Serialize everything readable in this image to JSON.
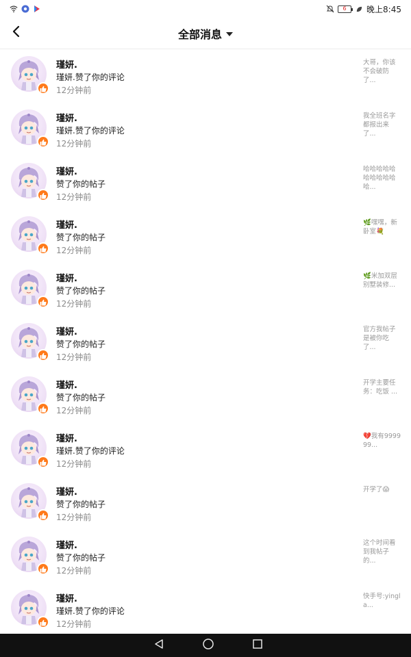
{
  "status_bar": {
    "time": "晚上8:45",
    "battery": "6"
  },
  "header": {
    "title": "全部消息"
  },
  "items": [
    {
      "name": "瑾妍.",
      "action": "瑾妍.赞了你的评论",
      "time": "12分钟前",
      "snippet": "大哥，你该不会破防了..."
    },
    {
      "name": "瑾妍.",
      "action": "瑾妍.赞了你的评论",
      "time": "12分钟前",
      "snippet": "我全班名字都报出来了..."
    },
    {
      "name": "瑾妍.",
      "action": "赞了你的帖子",
      "time": "12分钟前",
      "snippet": "哈哈哈哈哈哈哈哈哈哈哈..."
    },
    {
      "name": "瑾妍.",
      "action": "赞了你的帖子",
      "time": "12分钟前",
      "snippet": "🌿嘿嘿，新卧室💐"
    },
    {
      "name": "瑾妍.",
      "action": "赞了你的帖子",
      "time": "12分钟前",
      "snippet": "🌿米加双层别墅装修..."
    },
    {
      "name": "瑾妍.",
      "action": "赞了你的帖子",
      "time": "12分钟前",
      "snippet": "官方我帖子是被你吃了..."
    },
    {
      "name": "瑾妍.",
      "action": "赞了你的帖子",
      "time": "12分钟前",
      "snippet": "开学主要任务：吃饭 ..."
    },
    {
      "name": "瑾妍.",
      "action": "瑾妍.赞了你的评论",
      "time": "12分钟前",
      "snippet": "💔我有999999..."
    },
    {
      "name": "瑾妍.",
      "action": "赞了你的帖子",
      "time": "12分钟前",
      "snippet": "开学了😱"
    },
    {
      "name": "瑾妍.",
      "action": "赞了你的帖子",
      "time": "12分钟前",
      "snippet": "这个时间看到我帖子的..."
    },
    {
      "name": "瑾妍.",
      "action": "瑾妍.赞了你的评论",
      "time": "12分钟前",
      "snippet": "快手号:yingla..."
    }
  ],
  "colors": {
    "like_badge": "#ff7a1a",
    "nav_bar": "#111111",
    "avatar_bg": "#efe1f6"
  },
  "icons": {
    "back": "chevron-left-icon",
    "dropdown": "caret-down-icon",
    "like": "thumbs-up-icon",
    "nav_back": "triangle-back-icon",
    "nav_home": "circle-home-icon",
    "nav_recent": "square-recent-icon"
  }
}
